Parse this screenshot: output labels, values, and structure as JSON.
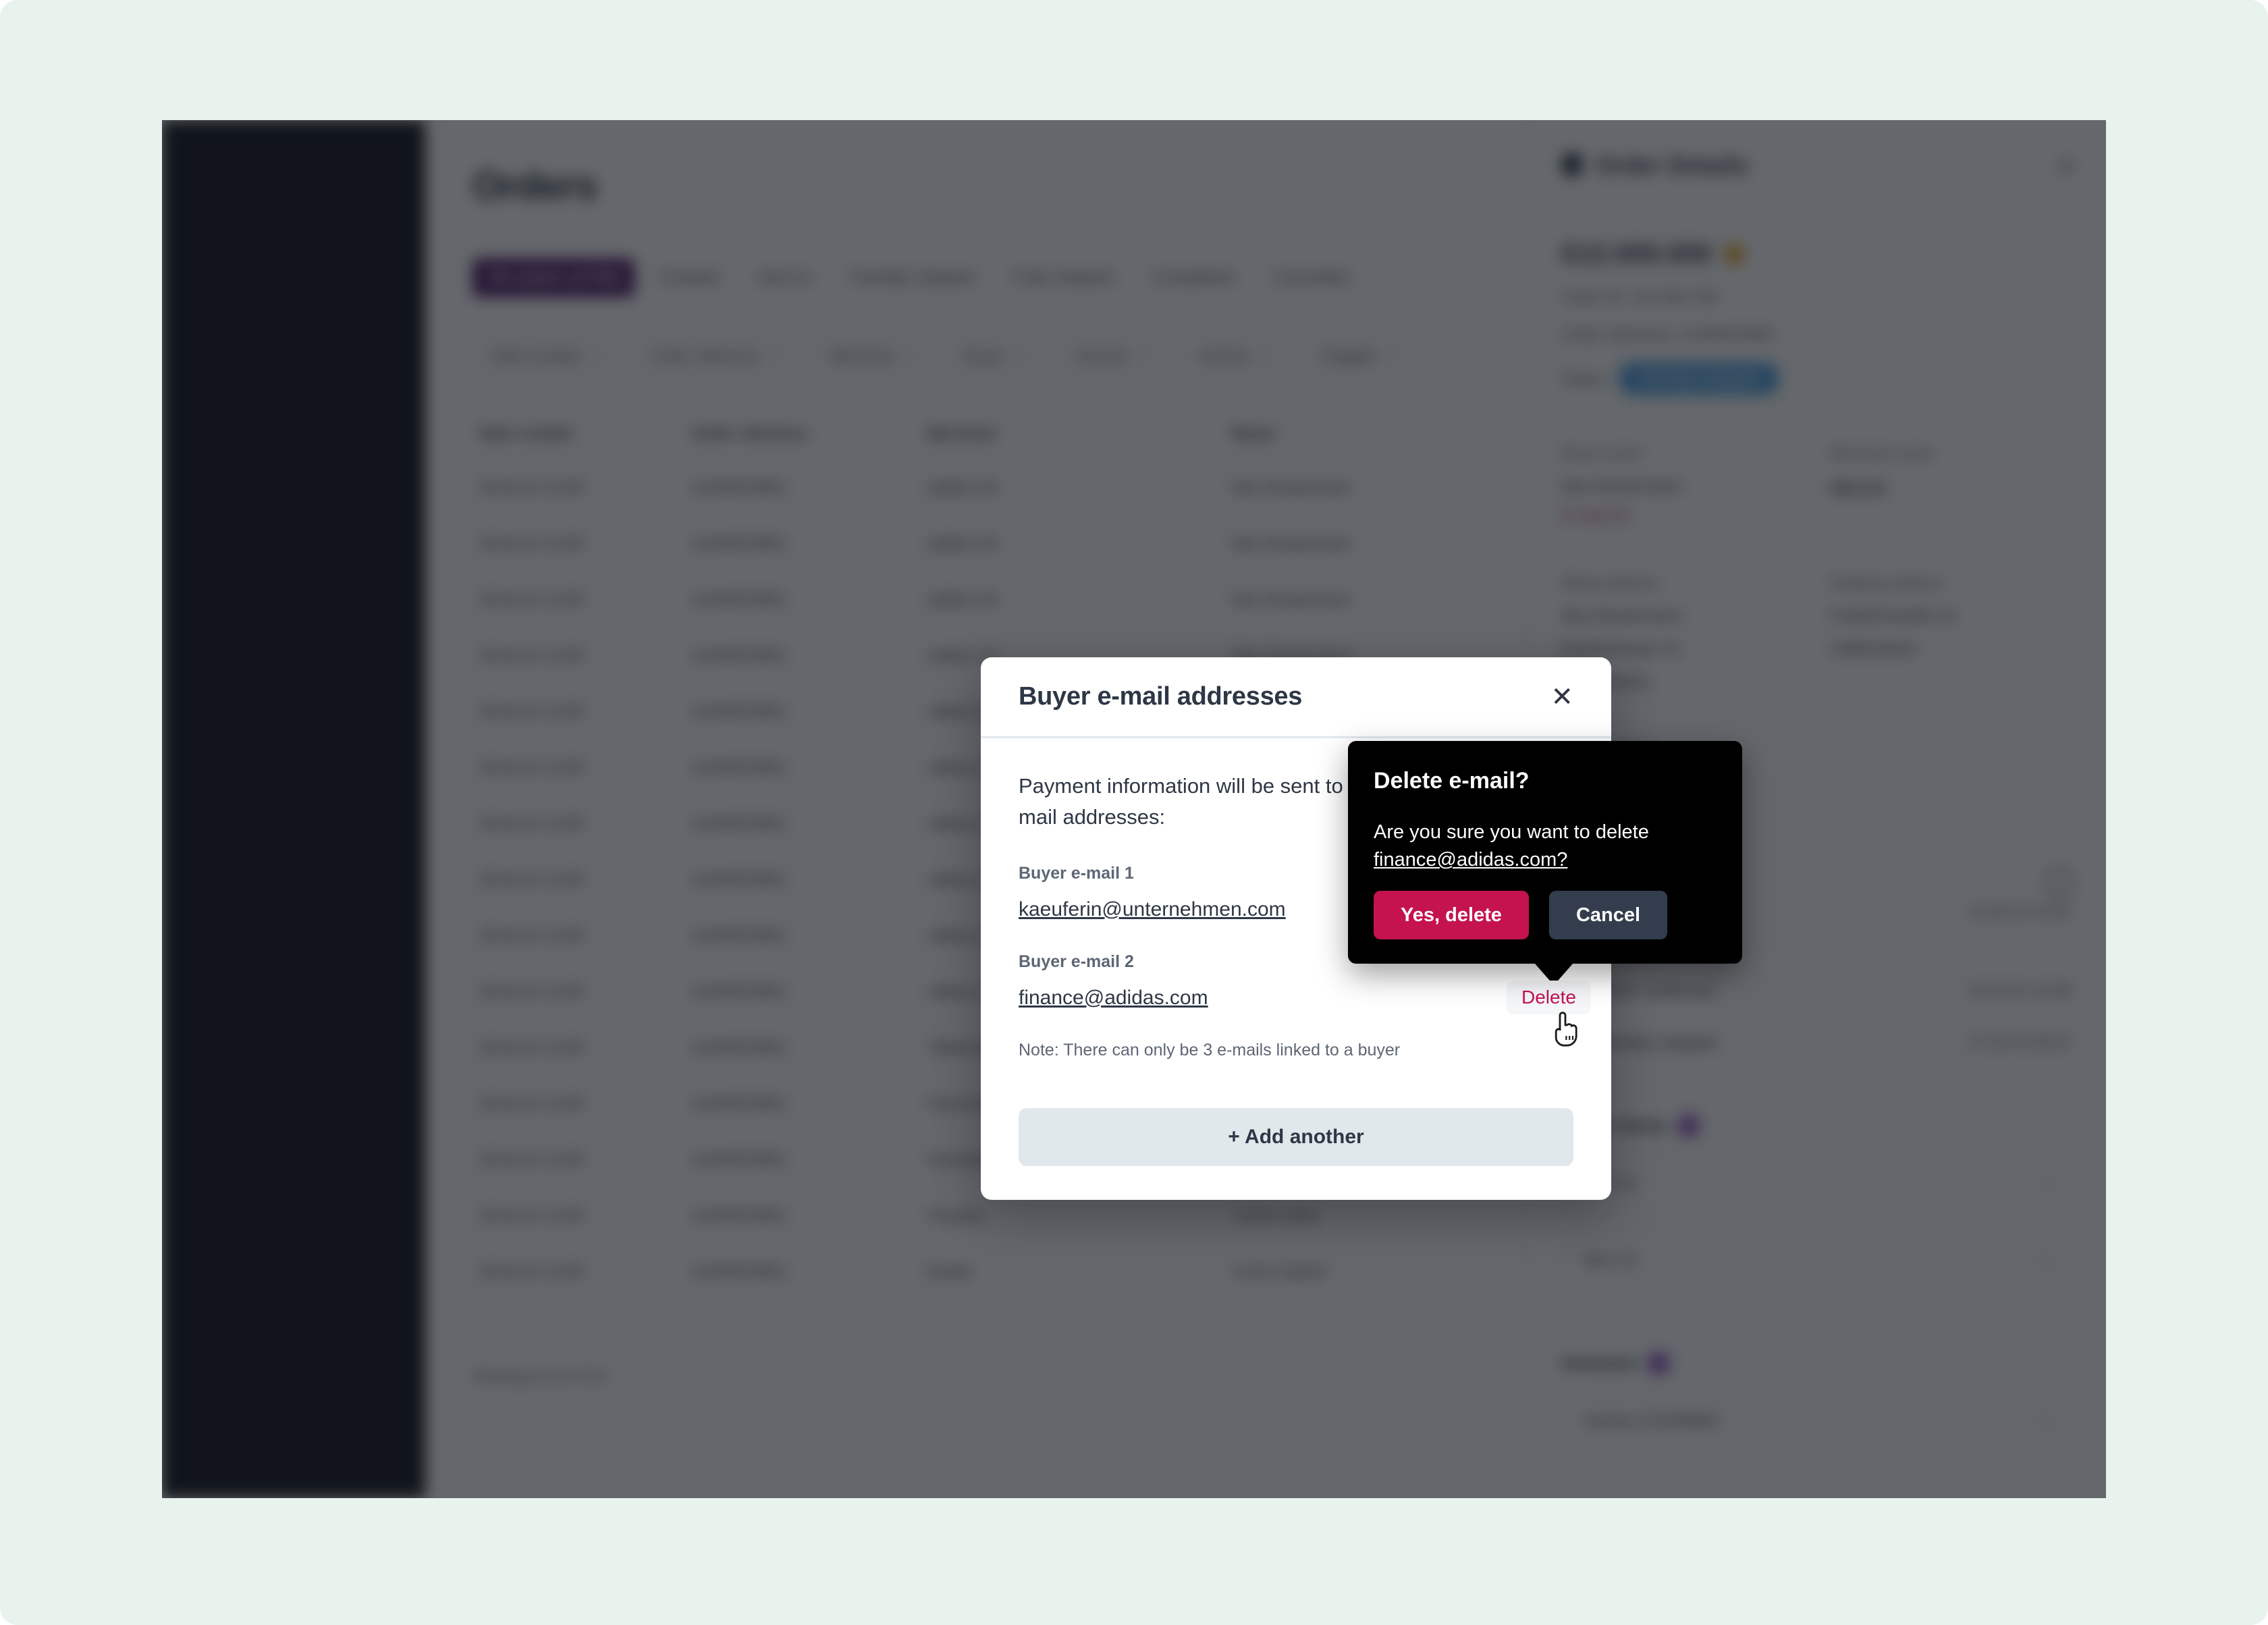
{
  "window": {
    "page_title": "Orders"
  },
  "tabs": [
    {
      "label": "All orders (1719)",
      "active": true
    },
    {
      "label": "Created",
      "active": false
    },
    {
      "label": "Sent to",
      "active": false
    },
    {
      "label": "Partially shipped",
      "active": false
    },
    {
      "label": "Fully shipped",
      "active": false
    },
    {
      "label": "Completed",
      "active": false
    },
    {
      "label": "Cancelled",
      "active": false
    }
  ],
  "filters": [
    {
      "label": "Date created",
      "caret": "chevron-down-icon"
    },
    {
      "label": "Order reference",
      "caret": "chevron-down-icon"
    },
    {
      "label": "Merchant",
      "caret": "chevron-down-icon"
    },
    {
      "label": "Buyer",
      "caret": "chevron-down-icon"
    },
    {
      "label": "Amount",
      "caret": "chevron-down-icon"
    },
    {
      "label": "Archive",
      "caret": "chevron-down-icon"
    },
    {
      "label": "Flagged",
      "caret": "chevron-down-icon"
    }
  ],
  "table": {
    "columns": [
      "Date created",
      "Order reference",
      "Merchant",
      "Buyer"
    ],
    "rows": [
      [
        "28.05.22 14:08",
        "12345678901",
        "adidas AG",
        "Max Mustermann"
      ],
      [
        "28.05.22 14:08",
        "12345678901",
        "adidas AG",
        "Max Mustermann"
      ],
      [
        "28.05.22 14:08",
        "12345678901",
        "adidas AG",
        "Max Mustermann"
      ],
      [
        "28.05.22 14:08",
        "12345678901",
        "adidas AG",
        "Max Mustermann"
      ],
      [
        "28.05.22 14:08",
        "12345678901",
        "adidas AG",
        "Max Mustermann"
      ],
      [
        "28.05.22 14:08",
        "12345678901",
        "adidas AG",
        "Max Mustermann"
      ],
      [
        "28.05.22 14:08",
        "12345678901",
        "adidas AG",
        "Max Mustermann"
      ],
      [
        "28.05.22 14:08",
        "12345678901",
        "adidas AG",
        "Max Mustermann"
      ],
      [
        "28.05.22 14:08",
        "12345678901",
        "adidas AG",
        "Max Mustermann"
      ],
      [
        "28.05.22 14:08",
        "12345678901",
        "adidas AG",
        "Max Mustermann"
      ],
      [
        "28.05.22 14:08",
        "12345678901",
        "Telekommunikation",
        "Max Mustermann"
      ],
      [
        "28.05.22 14:08",
        "12345678901",
        "Payments AG",
        "Erika Mustermann"
      ],
      [
        "28.05.22 14:08",
        "12345678901",
        "Handelsgruppe GmbH",
        "Lukas Lukas"
      ],
      [
        "28.05.22 14:08",
        "12345678901",
        "Showbiz",
        "Lukas Lukas"
      ],
      [
        "28.05.22 14:08",
        "12345678901",
        "Nestle",
        "Curtis Gabriel"
      ]
    ],
    "pagination": "Showing 15 of 1719"
  },
  "details_panel": {
    "icon": "bag-icon",
    "title": "Order Details",
    "close_icon": "close-icon",
    "amount": "€12.000.000",
    "currency_icon": "coin-icon",
    "order_id": "Order ID: 123 456 789",
    "order_reference": "Order reference: 12345678901",
    "status_label": "Status",
    "status_value": "Partially shipped",
    "buyer_name_label": "Buyer name",
    "buyer_name_value": "Max Mustermann",
    "buyer_email_link": "E-mail (2)",
    "merchant_name_label": "Merchant name",
    "merchant_name_value": "Nike AG",
    "billing_address_label": "Billing address",
    "billing_address": [
      "Max Mustermann",
      "Musterstrasse 41",
      "12345 Berlin"
    ],
    "shipping_address_label": "Shipping address",
    "shipping_address": [
      "Friedrichstraße 41",
      "10969 Berlin"
    ],
    "buyer_contact_label": "Buyer contact",
    "buyer_contact_value": "kaeuferin@unternehmen",
    "note_icon": "note-icon",
    "order_status_title": "Order status",
    "timeline": [
      {
        "label": "Order created",
        "sub": "24 mins ago",
        "time": "11.02.22 14:32"
      },
      {
        "label": "Order confirmed",
        "sub": "",
        "time": "16.02.22 12:08"
      },
      {
        "label": "Partially shipped",
        "sub": "",
        "time": "17.02.22 09:12"
      }
    ],
    "order_items_title": "Order items",
    "order_items_count": "2",
    "order_items": [
      {
        "label": "Item #1",
        "caret": "chevron-down-icon"
      },
      {
        "label": "Item #2",
        "caret": "chevron-down-icon"
      }
    ],
    "invoices_title": "Invoices",
    "invoices_count": "1",
    "invoices": [
      {
        "label": "Invoice #12345601",
        "caret": "chevron-down-icon"
      }
    ]
  },
  "modal": {
    "title": "Buyer e-mail addresses",
    "close_icon": "close-icon",
    "intro": "Payment information will be sent to the following e-mail addresses:",
    "emails": [
      {
        "label": "Buyer e-mail 1",
        "value": "kaeuferin@unternehmen.com"
      },
      {
        "label": "Buyer e-mail 2",
        "value": "finance@adidas.com"
      }
    ],
    "note": "Note: There can only be 3 e-mails linked to a buyer",
    "add_another_label": "+ Add another",
    "delete_link_label": "Delete"
  },
  "confirm_popover": {
    "title": "Delete e-mail?",
    "question_prefix": "Are you sure you want to delete ",
    "email": "finance@adidas.com?",
    "confirm_label": "Yes, delete",
    "cancel_label": "Cancel"
  },
  "colors": {
    "page_background": "#e7f3ec",
    "sidebar": "#0d1117",
    "accent_purple": "#4c1263",
    "danger_crimson": "#c4134f",
    "cancel_slate": "#333d4d",
    "popover_black": "#000000",
    "status_blue": "#4e9fe0",
    "badge_purple": "#8b3fbd",
    "coin_amber": "#eaa221",
    "add_button_bg": "#e1e8ec"
  },
  "cursor": {
    "type": "pointing-hand-cursor"
  }
}
